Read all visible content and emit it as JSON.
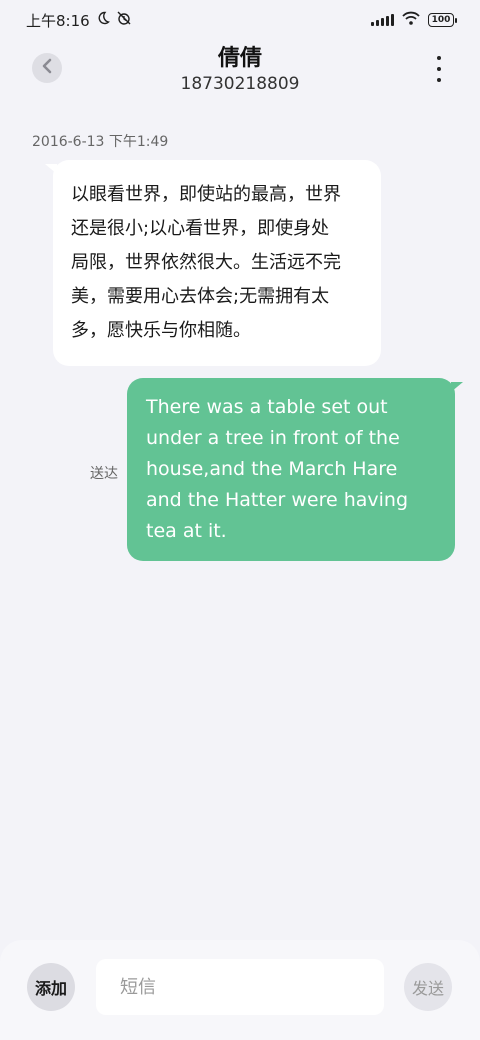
{
  "status_bar": {
    "time": "上午8:16",
    "icons": [
      "moon-icon",
      "alarm-off-icon",
      "signal-icon",
      "wifi-icon",
      "battery-icon"
    ],
    "battery": "100"
  },
  "header": {
    "title": "倩倩",
    "subtitle": "18730218809"
  },
  "conversation": {
    "timestamp": "2016-6-13 下午1:49",
    "incoming": {
      "lines": [
        "以眼看世界，即使站的最高，世界",
        "还是很小;以心看世界，即使身处",
        "局限，世界依然很大。生活远不完",
        "美，需要用心去体会;无需拥有太",
        "多，愿快乐与你相随。"
      ]
    },
    "outgoing": {
      "text": "There was a table set out under a tree in front of the house,and the March Hare and the Hatter were having tea at it.",
      "status": "送达"
    }
  },
  "composer": {
    "add_label": "添加",
    "input_placeholder": "短信",
    "send_label": "发送"
  },
  "colors": {
    "background": "#f3f3f8",
    "outgoing_bubble": "#62c394",
    "incoming_bubble": "#ffffff"
  }
}
